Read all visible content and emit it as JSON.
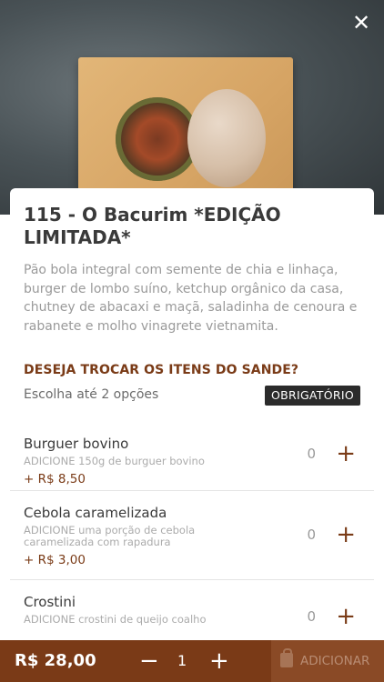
{
  "header": {
    "close_icon": "close-icon"
  },
  "product": {
    "title": "115 - O Bacurim *EDIÇÃO LIMITADA*",
    "description": "Pão bola integral com semente de chia e linhaça, burger de lombo suíno, ketchup orgânico da casa, chutney de abacaxi e maçã, saladinha de cenoura e rabanete e molho vinagrete vietnamita."
  },
  "section": {
    "title": "DESEJA TROCAR OS ITENS DO SANDE?",
    "subtitle": "Escolha até 2 opções",
    "badge": "OBRIGATÓRIO"
  },
  "options": [
    {
      "name": "Burguer bovino",
      "detail": "ADICIONE 150g de burguer bovino",
      "price": "+ R$ 8,50",
      "qty": "0",
      "plus": "+"
    },
    {
      "name": "Cebola caramelizada",
      "detail": "ADICIONE uma porção de cebola caramelizada com rapadura",
      "price": "+ R$ 3,00",
      "qty": "0",
      "plus": "+"
    },
    {
      "name": "Crostini",
      "detail": "ADICIONE crostini de queijo coalho",
      "price": "",
      "qty": "0",
      "plus": "+"
    }
  ],
  "footer": {
    "total": "R$ 28,00",
    "minus": "−",
    "quantity": "1",
    "plus": "+",
    "add_label": "ADICIONAR"
  },
  "colors": {
    "brand": "#7a3a17",
    "badge_bg": "#2b2b2b"
  }
}
